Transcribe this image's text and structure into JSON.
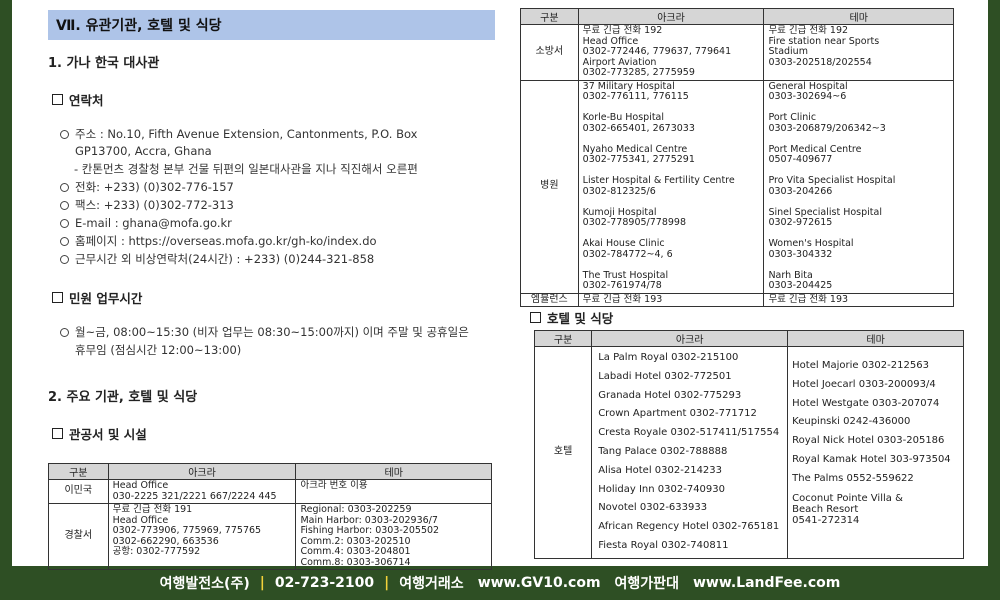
{
  "chapter_title": "Ⅶ. 유관기관, 호텔 및 식당",
  "section1": {
    "title": "1. 가나 한국 대사관",
    "contact_heading": "연락처",
    "address_line1": "주소 : No.10, Fifth Avenue Extension, Cantonments, P.O. Box",
    "address_line2": "GP13700, Accra, Ghana",
    "direction": "- 칸톤먼츠 경찰청 본부 건물 뒤편의 일본대사관을 지나 직진해서 오른편",
    "phone": "전화: +233) (0)302-776-157",
    "fax": "팩스: +233) (0)302-772-313",
    "email": "E-mail : ghana@mofa.go.kr",
    "homepage": "홈페이지 : https://overseas.mofa.go.kr/gh-ko/index.do",
    "emergency": "근무시간 외 비상연락처(24시간) : +233) (0)244-321-858",
    "hours_heading": "민원 업무시간",
    "hours_line1": "월~금, 08:00~15:30 (비자 업무는 08:30~15:00까지) 이며 주말 및 공휴일은",
    "hours_line2": "휴무임 (점심시간 12:00~13:00)"
  },
  "section2": {
    "title": "2. 주요 기관, 호텔 및 식당",
    "gov_heading": "관공서 및 시설",
    "hotel_heading": "호텔 및 식당"
  },
  "headers": {
    "category": "구분",
    "accra": "아크라",
    "tema": "테마"
  },
  "gov_table": [
    {
      "category": "이민국",
      "accra": [
        "Head Office",
        " 030-2225 321/2221 667/2224 445"
      ],
      "tema": [
        "아크라 번호 이용"
      ]
    },
    {
      "category": "경찰서",
      "accra": [
        "무료 긴급 전화 191",
        "Head Office",
        " 0302-773906, 775969, 775765",
        " 0302-662290, 663536",
        "공항: 0302-777592"
      ],
      "tema": [
        "Regional: 0303-202259",
        "Main Harbor: 0303-202936/7",
        "Fishing Harbor: 0303-205502",
        "Comm.2: 0303-202510",
        "Comm.4: 0303-204801",
        "Comm.8: 0303-306714"
      ]
    }
  ],
  "right_table": [
    {
      "category": "소방서",
      "accra": [
        "무료 긴급 전화 192",
        "Head Office",
        " 0302-772446, 779637, 779641",
        "Airport Aviation",
        " 0302-773285, 2775959"
      ],
      "tema": [
        "무료 긴급 전화 192",
        "Fire station near Sports",
        "Stadium",
        " 0303-202518/202554"
      ]
    },
    {
      "category": "병원",
      "accra": [
        "37 Military Hospital",
        " 0302-776111, 776115",
        "",
        "Korle-Bu Hospital",
        " 0302-665401, 2673033",
        "",
        "Nyaho Medical Centre",
        " 0302-775341, 2775291",
        "",
        "Lister Hospital & Fertility Centre",
        " 0302-812325/6",
        "",
        "Kumoji Hospital",
        " 0302-778905/778998",
        "",
        "Akai House Clinic",
        " 0302-784772~4, 6",
        "",
        "The Trust Hospital",
        " 0302-761974/78"
      ],
      "tema": [
        "General Hospital",
        " 0303-302694~6",
        "",
        "Port Clinic",
        " 0303-206879/206342~3",
        "",
        "Port Medical Centre",
        " 0507-409677",
        "",
        "Pro Vita Specialist Hospital",
        " 0303-204266",
        "",
        "Sinel Specialist Hospital",
        " 0302-972615",
        "",
        "Women's Hospital",
        " 0303-304332",
        "",
        "Narh Bita",
        " 0303-204425"
      ]
    },
    {
      "category": "엠뷸런스",
      "accra": [
        "무료 긴급 전화 193"
      ],
      "tema": [
        "무료 긴급 전화 193"
      ]
    }
  ],
  "hotel_table": {
    "category": "호텔",
    "accra": [
      "La Palm Royal 0302-215100",
      "Labadi Hotel 0302-772501",
      "Granada Hotel 0302-775293",
      "Crown Apartment 0302-771712",
      "Cresta Royale 0302-517411/517554",
      "Tang Palace 0302-788888",
      "Alisa Hotel 0302-214233",
      "Holiday Inn 0302-740930",
      "Novotel 0302-633933",
      "African Regency Hotel 0302-765181",
      "Fiesta Royal 0302-740811"
    ],
    "tema": [
      "Hotel Majorie 0302-212563",
      "Hotel Joecarl 0303-200093/4",
      "Hotel Westgate 0303-207074",
      "Keupinski 0242-436000",
      "Royal Nick Hotel 0303-205186",
      "Royal Kamak Hotel 303-973504",
      "The Palms 0552-559622",
      "Coconut Pointe Villa &",
      "Beach Resort",
      "0541-272314"
    ]
  },
  "footer": {
    "company": "여행발전소(주)",
    "phone": "02-723-2100",
    "exchange_label": "여행거래소",
    "exchange_url": "www.GV10.com",
    "price_label": "여행가판대",
    "price_url": "www.LandFee.com",
    "separator": "|"
  }
}
